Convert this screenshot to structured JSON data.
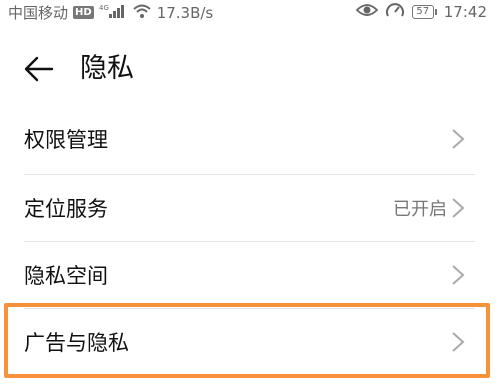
{
  "status_bar": {
    "carrier": "中国移动",
    "hd": "HD",
    "network": "4G",
    "speed": "17.3B/s",
    "battery": "57",
    "time": "17:42"
  },
  "header": {
    "title": "隐私"
  },
  "rows": [
    {
      "label": "权限管理",
      "value": ""
    },
    {
      "label": "定位服务",
      "value": "已开启"
    },
    {
      "label": "隐私空间",
      "value": ""
    },
    {
      "label": "广告与隐私",
      "value": ""
    }
  ],
  "colors": {
    "highlight": "#f7923b"
  }
}
